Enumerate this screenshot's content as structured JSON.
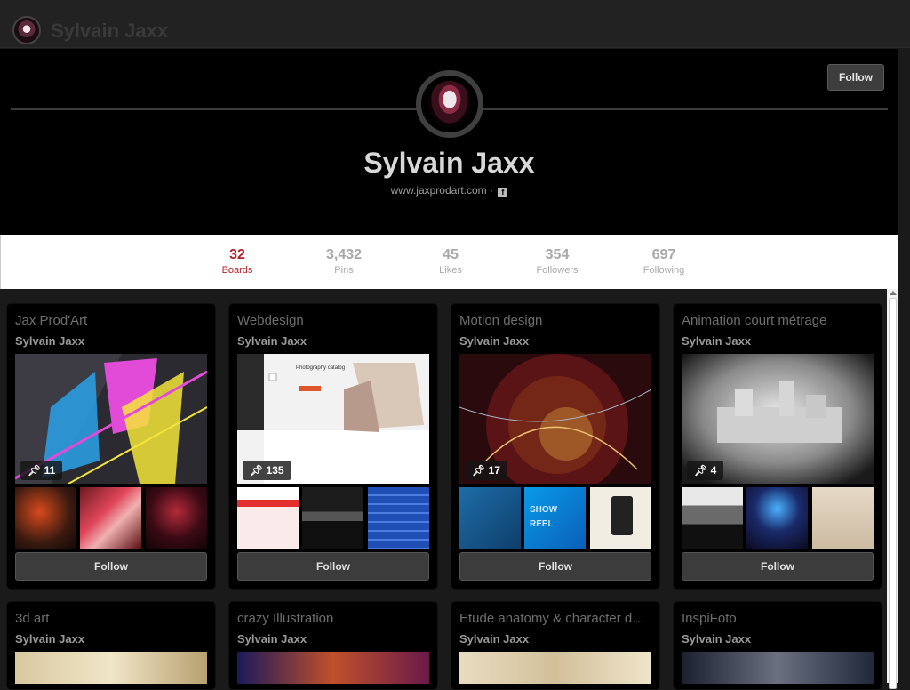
{
  "topbar": {
    "name": "Sylvain Jaxx"
  },
  "profile": {
    "name": "Sylvain Jaxx",
    "website": "www.jaxprodart.com",
    "separator": "·",
    "fb_glyph": "f",
    "follow_label": "Follow"
  },
  "stats": [
    {
      "num": "32",
      "label": "Boards"
    },
    {
      "num": "3,432",
      "label": "Pins"
    },
    {
      "num": "45",
      "label": "Likes"
    },
    {
      "num": "354",
      "label": "Followers"
    },
    {
      "num": "697",
      "label": "Following"
    }
  ],
  "boards": [
    {
      "title": "Jax Prod'Art",
      "owner": "Sylvain Jaxx",
      "pins": "11",
      "follow": "Follow"
    },
    {
      "title": "Webdesign",
      "owner": "Sylvain Jaxx",
      "pins": "135",
      "follow": "Follow",
      "cover_text": "Photography catalog"
    },
    {
      "title": "Motion design",
      "owner": "Sylvain Jaxx",
      "pins": "17",
      "follow": "Follow",
      "thumb_text": "SHOW REEL"
    },
    {
      "title": "Animation court métrage",
      "owner": "Sylvain Jaxx",
      "pins": "4",
      "follow": "Follow"
    },
    {
      "title": "3d art",
      "owner": "Sylvain Jaxx"
    },
    {
      "title": "crazy Illustration",
      "owner": "Sylvain Jaxx"
    },
    {
      "title": "Etude anatomy & character design",
      "owner": "Sylvain Jaxx"
    },
    {
      "title": "InspiFoto",
      "owner": "Sylvain Jaxx"
    }
  ],
  "icons": {
    "pin": "pin-icon",
    "facebook": "facebook-icon",
    "avatar": "avatar"
  },
  "colors": {
    "active_stat": "#b42025",
    "background": "#1a1a1a",
    "board_bg": "#000000"
  }
}
